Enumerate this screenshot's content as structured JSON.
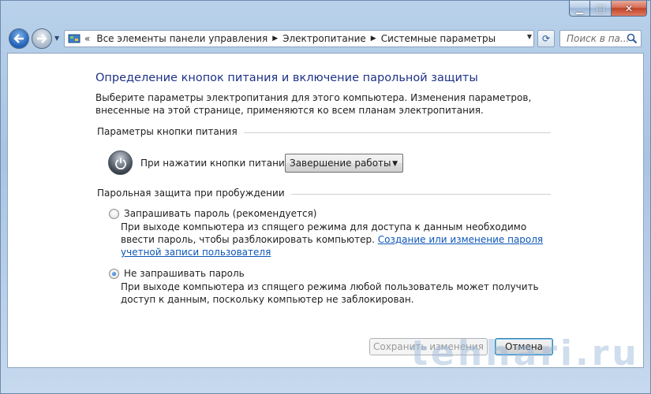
{
  "window": {
    "caption": {
      "minimize": "▁",
      "maximize": "□",
      "close": "✕"
    }
  },
  "navbar": {
    "breadcrumb": [
      "Все элементы панели управления",
      "Электропитание",
      "Системные параметры"
    ],
    "search_placeholder": "Поиск в па..."
  },
  "main": {
    "title": "Определение кнопок питания и включение парольной защиты",
    "description": "Выберите параметры электропитания для этого компьютера. Изменения параметров, внесенные на этой странице, применяются ко всем планам электропитания.",
    "power_group": {
      "header": "Параметры кнопки питания",
      "label": "При нажатии кнопки питания:",
      "selected": "Завершение работы"
    },
    "password_group": {
      "header": "Парольная защита при пробуждении",
      "options": [
        {
          "label": "Запрашивать пароль (рекомендуется)",
          "desc": "При выходе компьютера из спящего режима для доступа к данным необходимо ввести пароль, чтобы разблокировать компьютер. ",
          "link": "Создание или изменение пароля учетной записи пользователя",
          "checked": false
        },
        {
          "label": "Не запрашивать пароль",
          "desc": "При выходе компьютера из спящего режима любой пользователь может получить доступ к данным, поскольку компьютер не заблокирован.",
          "checked": true
        }
      ]
    },
    "buttons": {
      "save": "Сохранить изменения",
      "cancel": "Отмена"
    }
  },
  "watermark": "tehhari.ru",
  "colors": {
    "title": "#1e3287",
    "link": "#0d56b8",
    "window_frame": "#a9c4e2"
  }
}
